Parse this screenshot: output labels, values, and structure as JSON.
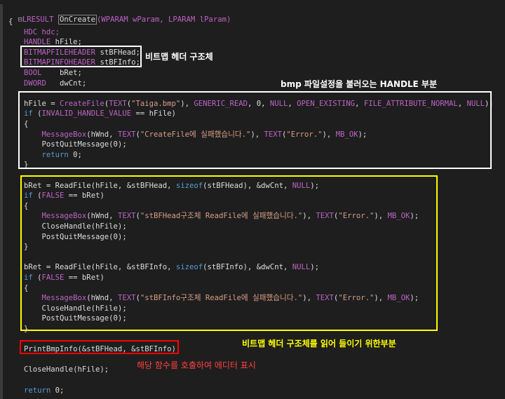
{
  "code": {
    "header": {
      "fold": "⊟",
      "ret_type": "LRESULT",
      "fn_name": "OnCreate",
      "params": "(WPARAM wParam, LPARAM lParam)"
    },
    "lines": [
      [
        {
          "t": "{",
          "c": "plain"
        }
      ],
      [
        {
          "t": "HDC hdc;",
          "c": "mac"
        }
      ],
      [
        {
          "t": "HANDLE ",
          "c": "mac"
        },
        {
          "t": "hFile;",
          "c": "plain"
        }
      ],
      [
        {
          "t": "BITMAPFILEHEADER ",
          "c": "mac"
        },
        {
          "t": "stBFHead;",
          "c": "plain"
        }
      ],
      [
        {
          "t": "BITMAPINFOHEADER ",
          "c": "mac"
        },
        {
          "t": "stBFInfo;",
          "c": "plain"
        }
      ],
      [
        {
          "t": "BOOL    ",
          "c": "mac"
        },
        {
          "t": "bRet;",
          "c": "plain"
        }
      ],
      [
        {
          "t": "DWORD   ",
          "c": "mac"
        },
        {
          "t": "dwCnt;",
          "c": "plain"
        }
      ],
      [],
      [
        {
          "t": "hFile = ",
          "c": "plain"
        },
        {
          "t": "CreateFile",
          "c": "mac"
        },
        {
          "t": "(",
          "c": "plain"
        },
        {
          "t": "TEXT",
          "c": "mac"
        },
        {
          "t": "(",
          "c": "plain"
        },
        {
          "t": "\"Taiga.bmp\"",
          "c": "str"
        },
        {
          "t": "), ",
          "c": "plain"
        },
        {
          "t": "GENERIC_READ",
          "c": "mac"
        },
        {
          "t": ", 0, ",
          "c": "plain"
        },
        {
          "t": "NULL",
          "c": "mac"
        },
        {
          "t": ", ",
          "c": "plain"
        },
        {
          "t": "OPEN_EXISTING",
          "c": "mac"
        },
        {
          "t": ", ",
          "c": "plain"
        },
        {
          "t": "FILE_ATTRIBUTE_NORMAL",
          "c": "mac"
        },
        {
          "t": ", ",
          "c": "plain"
        },
        {
          "t": "NULL",
          "c": "mac"
        },
        {
          "t": ");",
          "c": "plain"
        }
      ],
      [
        {
          "t": "if ",
          "c": "kw"
        },
        {
          "t": "(",
          "c": "plain"
        },
        {
          "t": "INVALID_HANDLE_VALUE",
          "c": "mac"
        },
        {
          "t": " == hFile)",
          "c": "plain"
        }
      ],
      [
        {
          "t": "{",
          "c": "plain"
        }
      ],
      [
        {
          "t": "    ",
          "c": "plain"
        },
        {
          "t": "MessageBox",
          "c": "mac"
        },
        {
          "t": "(hWnd, ",
          "c": "plain"
        },
        {
          "t": "TEXT",
          "c": "mac"
        },
        {
          "t": "(",
          "c": "plain"
        },
        {
          "t": "\"CreateFile에 실패했습니다.\"",
          "c": "str"
        },
        {
          "t": "), ",
          "c": "plain"
        },
        {
          "t": "TEXT",
          "c": "mac"
        },
        {
          "t": "(",
          "c": "plain"
        },
        {
          "t": "\"Error.\"",
          "c": "str"
        },
        {
          "t": "), ",
          "c": "plain"
        },
        {
          "t": "MB_OK",
          "c": "mac"
        },
        {
          "t": ");",
          "c": "plain"
        }
      ],
      [
        {
          "t": "    PostQuitMessage(0);",
          "c": "plain"
        }
      ],
      [
        {
          "t": "    ",
          "c": "plain"
        },
        {
          "t": "return ",
          "c": "kw"
        },
        {
          "t": "0;",
          "c": "plain"
        }
      ],
      [
        {
          "t": "}",
          "c": "plain"
        }
      ],
      [],
      [
        {
          "t": "bRet = ReadFile(hFile, &stBFHead, ",
          "c": "plain"
        },
        {
          "t": "sizeof",
          "c": "kw"
        },
        {
          "t": "(stBFHead), &dwCnt, ",
          "c": "plain"
        },
        {
          "t": "NULL",
          "c": "mac"
        },
        {
          "t": ");",
          "c": "plain"
        }
      ],
      [
        {
          "t": "if ",
          "c": "kw"
        },
        {
          "t": "(",
          "c": "plain"
        },
        {
          "t": "FALSE",
          "c": "mac"
        },
        {
          "t": " == bRet)",
          "c": "plain"
        }
      ],
      [
        {
          "t": "{",
          "c": "plain"
        }
      ],
      [
        {
          "t": "    ",
          "c": "plain"
        },
        {
          "t": "MessageBox",
          "c": "mac"
        },
        {
          "t": "(hWnd, ",
          "c": "plain"
        },
        {
          "t": "TEXT",
          "c": "mac"
        },
        {
          "t": "(",
          "c": "plain"
        },
        {
          "t": "\"stBFHead구조체 ReadFile에 실패했습니다.\"",
          "c": "str"
        },
        {
          "t": "), ",
          "c": "plain"
        },
        {
          "t": "TEXT",
          "c": "mac"
        },
        {
          "t": "(",
          "c": "plain"
        },
        {
          "t": "\"Error.\"",
          "c": "str"
        },
        {
          "t": "), ",
          "c": "plain"
        },
        {
          "t": "MB_OK",
          "c": "mac"
        },
        {
          "t": ");",
          "c": "plain"
        }
      ],
      [
        {
          "t": "    CloseHandle(hFile);",
          "c": "plain"
        }
      ],
      [
        {
          "t": "    PostQuitMessage(0);",
          "c": "plain"
        }
      ],
      [
        {
          "t": "}",
          "c": "plain"
        }
      ],
      [],
      [
        {
          "t": "bRet = ReadFile(hFile, &stBFInfo, ",
          "c": "plain"
        },
        {
          "t": "sizeof",
          "c": "kw"
        },
        {
          "t": "(stBFInfo), &dwCnt, ",
          "c": "plain"
        },
        {
          "t": "NULL",
          "c": "mac"
        },
        {
          "t": ");",
          "c": "plain"
        }
      ],
      [
        {
          "t": "if ",
          "c": "kw"
        },
        {
          "t": "(",
          "c": "plain"
        },
        {
          "t": "FALSE",
          "c": "mac"
        },
        {
          "t": " == bRet)",
          "c": "plain"
        }
      ],
      [
        {
          "t": "{",
          "c": "plain"
        }
      ],
      [
        {
          "t": "    ",
          "c": "plain"
        },
        {
          "t": "MessageBox",
          "c": "mac"
        },
        {
          "t": "(hWnd, ",
          "c": "plain"
        },
        {
          "t": "TEXT",
          "c": "mac"
        },
        {
          "t": "(",
          "c": "plain"
        },
        {
          "t": "\"stBFInfo구조체 ReadFile에 실패했습니다.\"",
          "c": "str"
        },
        {
          "t": "), ",
          "c": "plain"
        },
        {
          "t": "TEXT",
          "c": "mac"
        },
        {
          "t": "(",
          "c": "plain"
        },
        {
          "t": "\"Error.\"",
          "c": "str"
        },
        {
          "t": "), ",
          "c": "plain"
        },
        {
          "t": "MB_OK",
          "c": "mac"
        },
        {
          "t": ");",
          "c": "plain"
        }
      ],
      [
        {
          "t": "    CloseHandle(hFile);",
          "c": "plain"
        }
      ],
      [
        {
          "t": "    PostQuitMessage(0);",
          "c": "plain"
        }
      ],
      [
        {
          "t": "}",
          "c": "plain"
        }
      ],
      [],
      [
        {
          "t": "PrintBmpInfo(&stBFHead, &stBFInfo);",
          "c": "plain"
        }
      ],
      [],
      [
        {
          "t": "CloseHandle(hFile);",
          "c": "plain"
        }
      ],
      [],
      [
        {
          "t": "return ",
          "c": "kw"
        },
        {
          "t": "0;",
          "c": "plain"
        }
      ]
    ]
  },
  "annotations": {
    "struct_label": "비트맵 헤더 구조체",
    "handle_label": "bmp 파일설정을 불러오는 HANDLE 부분",
    "read_label": "비트맵 헤더 구조체를 읽어 들이기 위한부분",
    "print_label": "해당 함수를 호출하여 에디터 표시"
  },
  "colors": {
    "background": "#1e1e1e",
    "keyword": "#569cd6",
    "macro": "#bd63c5",
    "string": "#d69d85",
    "box_white": "#ffffff",
    "box_yellow": "#ffff00",
    "box_red": "#ff0000"
  }
}
